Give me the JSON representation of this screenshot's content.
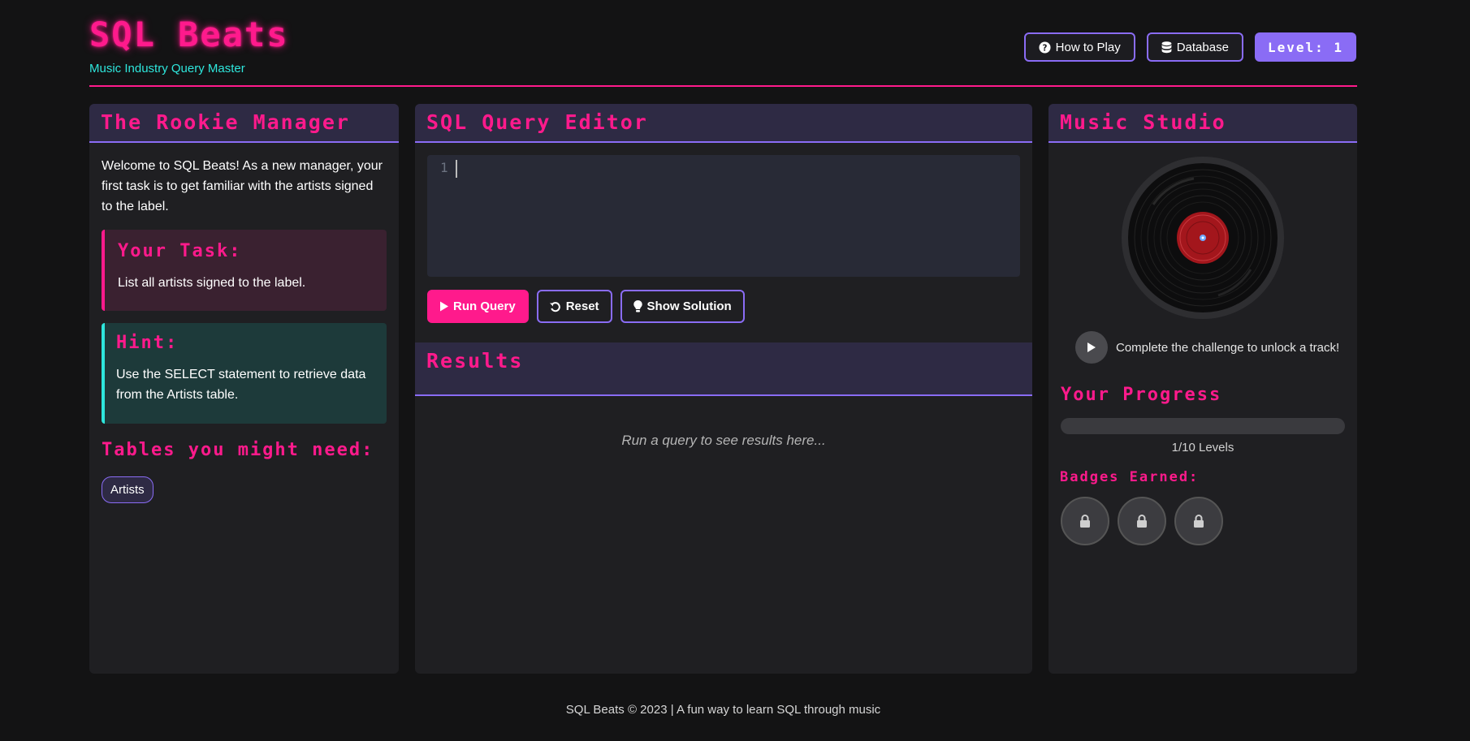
{
  "header": {
    "title": "SQL Beats",
    "tagline": "Music Industry Query Master",
    "how_to_play": "How to Play",
    "database": "Database",
    "level_label": "Level: 1"
  },
  "left_panel": {
    "title": "The Rookie Manager",
    "welcome": "Welcome to SQL Beats! As a new manager, your first task is to get familiar with the artists signed to the label.",
    "task_title": "Your Task:",
    "task_text": "List all artists signed to the label.",
    "hint_title": "Hint:",
    "hint_text": "Use the SELECT statement to retrieve data from the Artists table.",
    "tables_title": "Tables you might need:",
    "tables": [
      "Artists"
    ]
  },
  "editor": {
    "title": "SQL Query Editor",
    "line_number": "1",
    "query": "",
    "run_label": "Run Query",
    "reset_label": "Reset",
    "solution_label": "Show Solution"
  },
  "results": {
    "title": "Results",
    "empty_text": "Run a query to see results here..."
  },
  "studio": {
    "title": "Music Studio",
    "unlock_text": "Complete the challenge to unlock a track!",
    "progress_title": "Your Progress",
    "progress_fraction": 0.0,
    "progress_label": "1/10 Levels",
    "badges_title": "Badges Earned:",
    "badges": [
      {
        "icon": "lock-icon",
        "locked": true
      },
      {
        "icon": "lock-icon",
        "locked": true
      },
      {
        "icon": "lock-icon",
        "locked": true
      }
    ]
  },
  "colors": {
    "accent_pink": "#ff1a8c",
    "accent_purple": "#8a6cf5",
    "accent_cyan": "#2ee6dc",
    "background": "#131314"
  },
  "footer": {
    "text": "SQL Beats © 2023 | A fun way to learn SQL through music"
  }
}
